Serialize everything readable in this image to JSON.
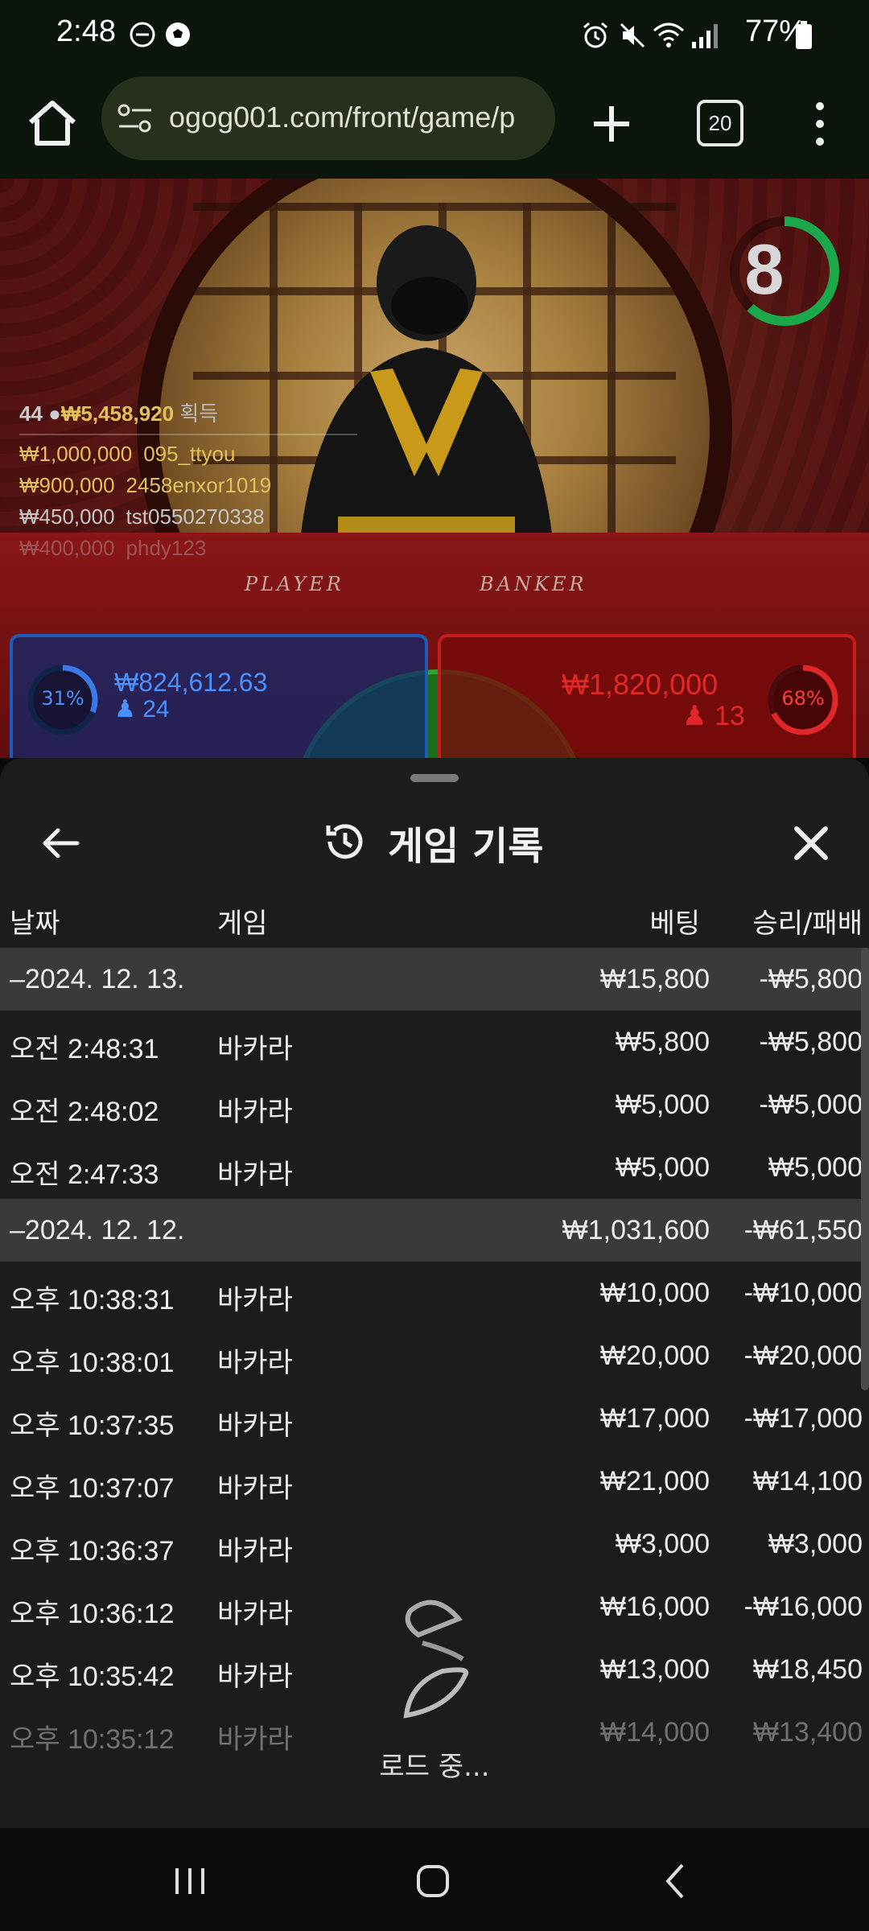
{
  "status_bar": {
    "time": "2:48",
    "battery": "77%",
    "icons": [
      "minus-circle-icon",
      "soccer-ball-icon",
      "alarm-icon",
      "mute-icon",
      "wifi-icon",
      "signal-icon",
      "battery-icon"
    ]
  },
  "browser": {
    "url": "ogog001.com/front/game/p",
    "tab_count": "20"
  },
  "game": {
    "timer": "8",
    "winners_count": "44",
    "winners_total": "₩5,458,920",
    "winners_label": "획득",
    "winners": [
      {
        "amount": "₩1,000,000",
        "name": "095_ttyou"
      },
      {
        "amount": "₩900,000",
        "name": "2458enxor1019"
      },
      {
        "amount": "₩450,000",
        "name": "tst0550270338"
      },
      {
        "amount": "₩400,000",
        "name": "phdy123"
      }
    ],
    "table_labels": {
      "player": "PLAYER",
      "banker": "BANKER"
    },
    "player": {
      "percent": "31%",
      "amount": "₩824,612.63",
      "count": "24"
    },
    "banker": {
      "percent": "68%",
      "amount": "₩1,820,000",
      "count": "13"
    },
    "tie": {
      "percent": "1%"
    },
    "colors": {
      "player": "#1e5bb8",
      "banker": "#c41b1b",
      "tie": "#2ea52e",
      "timer": "#1aa84a"
    }
  },
  "history": {
    "title": "게임 기록",
    "columns": {
      "date": "날짜",
      "game": "게임",
      "bet": "베팅",
      "result": "승리/패배"
    },
    "rows": [
      {
        "type": "group",
        "date": "–2024. 12. 13.",
        "game": "",
        "bet": "₩15,800",
        "result": "-₩5,800"
      },
      {
        "type": "item",
        "date": "오전 2:48:31",
        "game": "바카라",
        "bet": "₩5,800",
        "result": "-₩5,800"
      },
      {
        "type": "item",
        "date": "오전 2:48:02",
        "game": "바카라",
        "bet": "₩5,000",
        "result": "-₩5,000"
      },
      {
        "type": "item",
        "date": "오전 2:47:33",
        "game": "바카라",
        "bet": "₩5,000",
        "result": "₩5,000"
      },
      {
        "type": "group",
        "date": "–2024. 12. 12.",
        "game": "",
        "bet": "₩1,031,600",
        "result": "-₩61,550"
      },
      {
        "type": "item",
        "date": "오후 10:38:31",
        "game": "바카라",
        "bet": "₩10,000",
        "result": "-₩10,000"
      },
      {
        "type": "item",
        "date": "오후 10:38:01",
        "game": "바카라",
        "bet": "₩20,000",
        "result": "-₩20,000"
      },
      {
        "type": "item",
        "date": "오후 10:37:35",
        "game": "바카라",
        "bet": "₩17,000",
        "result": "-₩17,000"
      },
      {
        "type": "item",
        "date": "오후 10:37:07",
        "game": "바카라",
        "bet": "₩21,000",
        "result": "₩14,100"
      },
      {
        "type": "item",
        "date": "오후 10:36:37",
        "game": "바카라",
        "bet": "₩3,000",
        "result": "₩3,000"
      },
      {
        "type": "item",
        "date": "오후 10:36:12",
        "game": "바카라",
        "bet": "₩16,000",
        "result": "-₩16,000"
      },
      {
        "type": "item",
        "date": "오후 10:35:42",
        "game": "바카라",
        "bet": "₩13,000",
        "result": "₩18,450"
      },
      {
        "type": "item",
        "date": "오후 10:35:12",
        "game": "바카라",
        "bet": "₩14,000",
        "result": "₩13,400"
      }
    ],
    "loading_text": "로드 중..."
  }
}
